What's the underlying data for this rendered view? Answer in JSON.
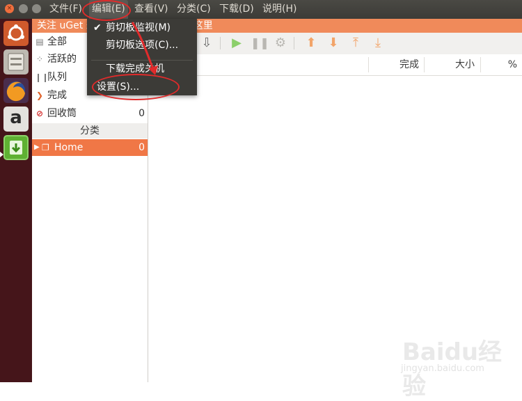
{
  "menubar": {
    "items": [
      {
        "label": "文件(F)"
      },
      {
        "label": "编辑(E)"
      },
      {
        "label": "查看(V)"
      },
      {
        "label": "分类(C)"
      },
      {
        "label": "下载(D)"
      },
      {
        "label": "说明(H)"
      }
    ],
    "close_glyph": "×"
  },
  "banner": {
    "text": "关注 uGet 未来发展的募捐，请点击这里"
  },
  "sidebar": {
    "states": [
      {
        "label": "全部",
        "count": ""
      },
      {
        "label": "活跃的",
        "count": ""
      },
      {
        "label": "队列",
        "count": ""
      },
      {
        "label": "完成",
        "count": ""
      },
      {
        "label": "回收筒",
        "count": "0"
      }
    ],
    "section_title": "分类",
    "categories": [
      {
        "label": "Home",
        "count": "0"
      }
    ]
  },
  "list": {
    "columns": [
      {
        "label": "完成"
      },
      {
        "label": "大小"
      },
      {
        "label": "%"
      }
    ]
  },
  "dropdown": {
    "items": [
      {
        "label": "剪切板监视(M)",
        "checked": true
      },
      {
        "label": "剪切板选项(C)..."
      },
      {
        "label": "下载完成关机"
      },
      {
        "label": "设置(S)..."
      }
    ],
    "check_glyph": "✔"
  },
  "launcher": {
    "amazon_glyph": "a"
  },
  "watermark": {
    "logo": "Baidu经验",
    "url": "jingyan.baidu.com"
  },
  "colors": {
    "accent": "#f07746",
    "annotation": "#e12b2b",
    "menubar": "#3c3b37"
  }
}
